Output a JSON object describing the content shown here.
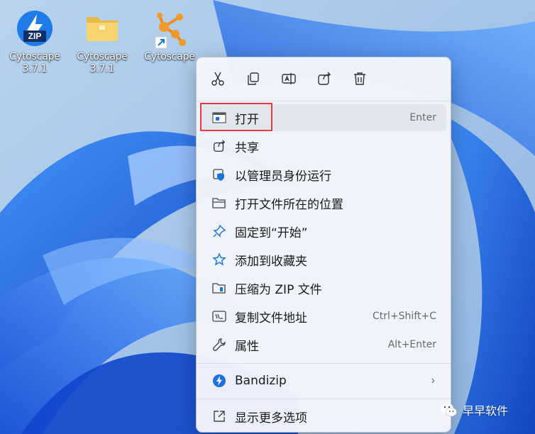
{
  "desktop": {
    "icons": [
      {
        "label_line1": "Cytoscape",
        "label_line2": "3.7.1",
        "icon": "zip-archive-icon",
        "badge": "ZIP"
      },
      {
        "label_line1": "Cytoscape",
        "label_line2": "3.7.1",
        "icon": "folder-icon"
      },
      {
        "label_line1": "Cytoscape",
        "label_line2": "",
        "icon": "cytoscape-shortcut-icon"
      }
    ]
  },
  "context_menu": {
    "toolbar": [
      {
        "icon": "cut-icon"
      },
      {
        "icon": "copy-icon"
      },
      {
        "icon": "rename-icon"
      },
      {
        "icon": "share-icon"
      },
      {
        "icon": "delete-icon"
      }
    ],
    "items": [
      {
        "label": "打开",
        "shortcut": "Enter",
        "icon": "open-app-icon"
      },
      {
        "label": "共享",
        "shortcut": "",
        "icon": "share-icon"
      },
      {
        "label": "以管理员身份运行",
        "shortcut": "",
        "icon": "admin-shield-icon"
      },
      {
        "label": "打开文件所在的位置",
        "shortcut": "",
        "icon": "folder-open-icon"
      },
      {
        "label": "固定到“开始”",
        "shortcut": "",
        "icon": "pin-icon"
      },
      {
        "label": "添加到收藏夹",
        "shortcut": "",
        "icon": "star-icon"
      },
      {
        "label": "压缩为 ZIP 文件",
        "shortcut": "",
        "icon": "zip-folder-icon"
      },
      {
        "label": "复制文件地址",
        "shortcut": "Ctrl+Shift+C",
        "icon": "copy-path-icon"
      },
      {
        "label": "属性",
        "shortcut": "Alt+Enter",
        "icon": "wrench-icon"
      },
      {
        "label": "Bandizip",
        "shortcut": "",
        "icon": "bandizip-icon",
        "submenu": true
      },
      {
        "label": "显示更多选项",
        "shortcut": "",
        "icon": "more-options-icon"
      }
    ]
  },
  "watermark": {
    "text": "早早软件",
    "icon": "wechat-icon"
  },
  "colors": {
    "highlight_border": "#e23b3b",
    "accent": "#1a73d9",
    "menu_bg": "#f3f5fa"
  }
}
